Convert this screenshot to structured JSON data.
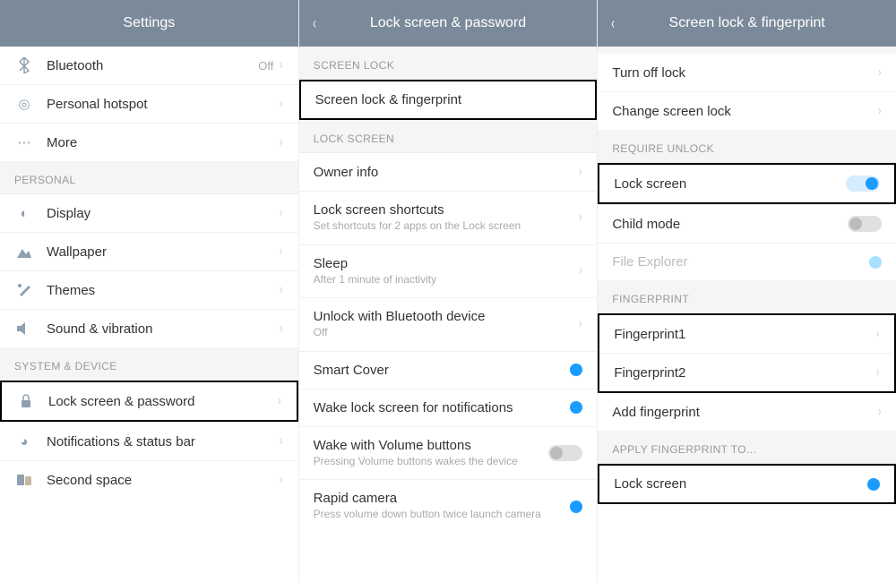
{
  "panels": {
    "settings": {
      "title": "Settings",
      "items": {
        "bluetooth": {
          "label": "Bluetooth",
          "value": "Off"
        },
        "hotspot": {
          "label": "Personal hotspot"
        },
        "more": {
          "label": "More"
        }
      },
      "sections": {
        "personal": {
          "header": "PERSONAL",
          "display": {
            "label": "Display"
          },
          "wallpaper": {
            "label": "Wallpaper"
          },
          "themes": {
            "label": "Themes"
          },
          "sound": {
            "label": "Sound & vibration"
          }
        },
        "system": {
          "header": "SYSTEM & DEVICE",
          "lock": {
            "label": "Lock screen & password"
          },
          "notif": {
            "label": "Notifications & status bar"
          },
          "space": {
            "label": "Second space"
          }
        }
      }
    },
    "lockpw": {
      "title": "Lock screen & password",
      "sections": {
        "screenlock": {
          "header": "SCREEN LOCK",
          "item": {
            "label": "Screen lock & fingerprint"
          }
        },
        "lockscreen": {
          "header": "LOCK SCREEN",
          "owner": {
            "label": "Owner info"
          },
          "shortcuts": {
            "label": "Lock screen shortcuts",
            "sub": "Set shortcuts for 2 apps on the Lock screen"
          },
          "sleep": {
            "label": "Sleep",
            "sub": "After 1 minute of inactivity"
          },
          "btunlock": {
            "label": "Unlock with Bluetooth device",
            "sub": "Off"
          },
          "smart": {
            "label": "Smart Cover",
            "on": true
          },
          "wake": {
            "label": "Wake lock screen for notifications",
            "on": true
          },
          "wakevol": {
            "label": "Wake with Volume buttons",
            "sub": "Pressing Volume buttons wakes the device"
          },
          "rapid": {
            "label": "Rapid camera",
            "sub": "Press volume down button twice launch camera",
            "on": true
          }
        }
      }
    },
    "fp": {
      "title": "Screen lock & fingerprint",
      "items": {
        "turnoff": {
          "label": "Turn off lock"
        },
        "change": {
          "label": "Change screen lock"
        }
      },
      "sections": {
        "require": {
          "header": "REQUIRE UNLOCK",
          "lockscreen": {
            "label": "Lock screen",
            "on": true
          },
          "child": {
            "label": "Child mode"
          },
          "file": {
            "label": "File Explorer"
          }
        },
        "fingerprint": {
          "header": "FINGERPRINT",
          "fp1": {
            "label": "Fingerprint1"
          },
          "fp2": {
            "label": "Fingerprint2"
          },
          "add": {
            "label": "Add fingerprint"
          }
        },
        "apply": {
          "header": "APPLY FINGERPRINT TO...",
          "lockscreen": {
            "label": "Lock screen",
            "on": true
          }
        }
      }
    }
  }
}
